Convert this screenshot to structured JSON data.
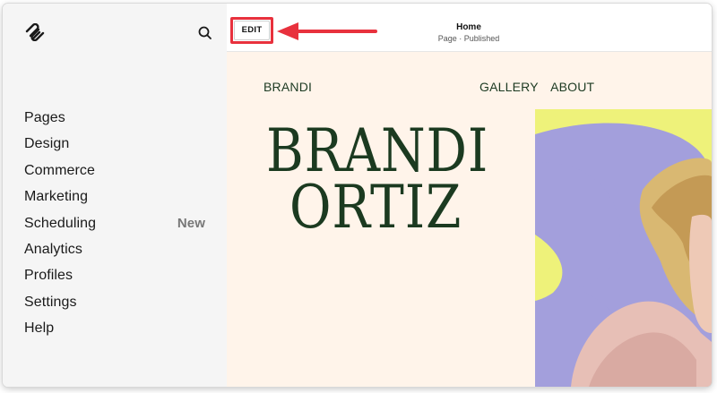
{
  "sidebar": {
    "logo": "squarespace-logo",
    "search_icon": "search-icon",
    "items": [
      {
        "label": "Pages"
      },
      {
        "label": "Design"
      },
      {
        "label": "Commerce"
      },
      {
        "label": "Marketing"
      },
      {
        "label": "Scheduling",
        "badge": "New"
      },
      {
        "label": "Analytics"
      },
      {
        "label": "Profiles"
      },
      {
        "label": "Settings"
      },
      {
        "label": "Help"
      }
    ]
  },
  "topbar": {
    "edit_label": "EDIT",
    "page_title": "Home",
    "page_status": "Page · Published",
    "highlight_color": "#e8313d"
  },
  "site": {
    "brand": "BRANDI",
    "nav_links": [
      "GALLERY",
      "ABOUT"
    ],
    "hero_line1": "BRANDI",
    "hero_line2": "ORTIZ",
    "colors": {
      "background": "#fff4ea",
      "text": "#1b3a20",
      "shape_purple": "#a39fdc",
      "shape_yellow": "#eef27a"
    }
  }
}
